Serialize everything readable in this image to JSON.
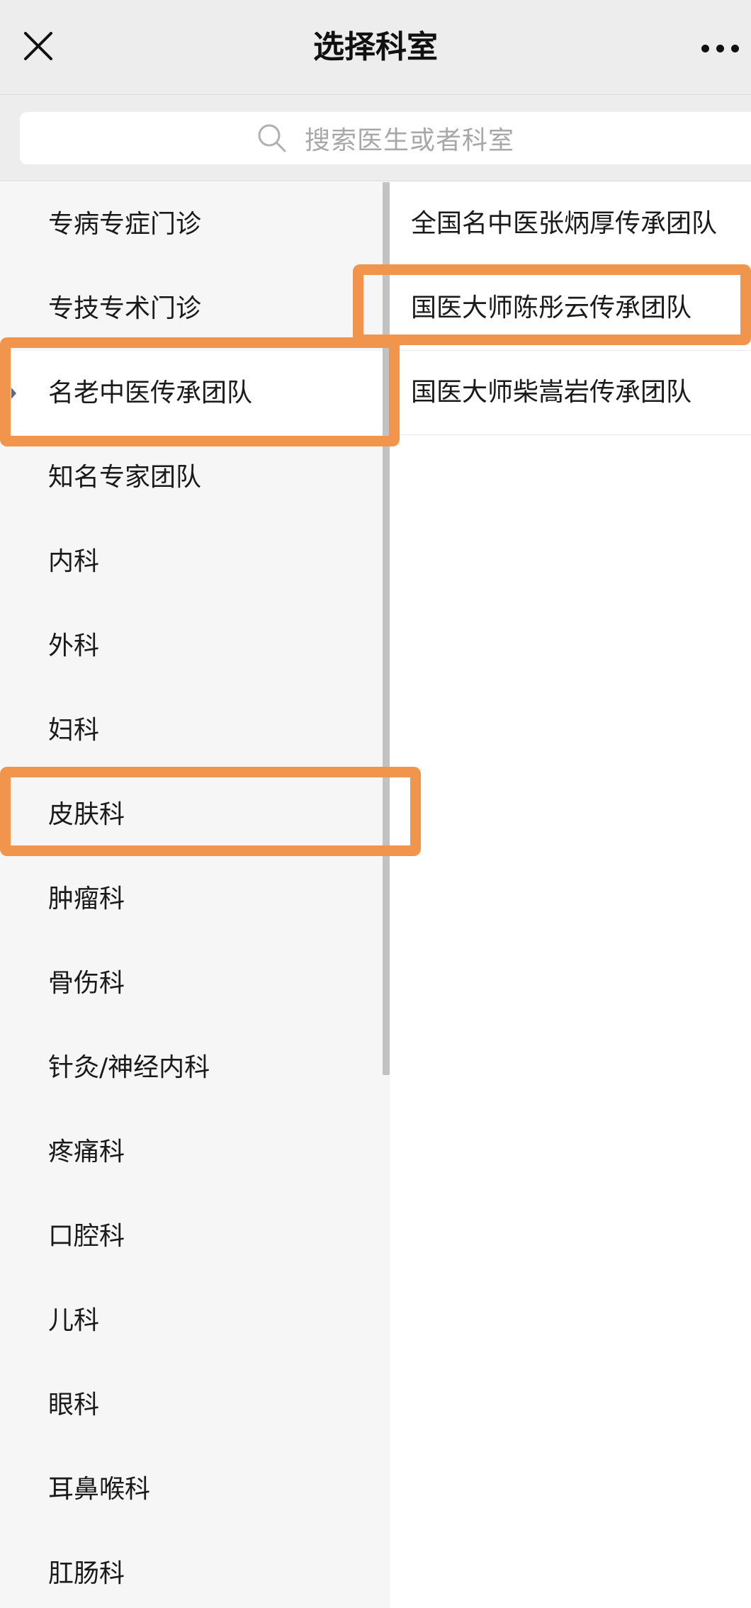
{
  "header": {
    "title": "选择科室",
    "close_icon": "close-icon",
    "more_icon": "more-dots-icon"
  },
  "search": {
    "placeholder": "搜索医生或者科室",
    "icon": "search-icon"
  },
  "departments": [
    {
      "label": "专病专症门诊",
      "active": false
    },
    {
      "label": "专技专术门诊",
      "active": false
    },
    {
      "label": "名老中医传承团队",
      "active": true
    },
    {
      "label": "知名专家团队",
      "active": false
    },
    {
      "label": "内科",
      "active": false
    },
    {
      "label": "外科",
      "active": false
    },
    {
      "label": "妇科",
      "active": false
    },
    {
      "label": "皮肤科",
      "active": false
    },
    {
      "label": "肿瘤科",
      "active": false
    },
    {
      "label": "骨伤科",
      "active": false
    },
    {
      "label": "针灸/神经内科",
      "active": false
    },
    {
      "label": "疼痛科",
      "active": false
    },
    {
      "label": "口腔科",
      "active": false
    },
    {
      "label": "儿科",
      "active": false
    },
    {
      "label": "眼科",
      "active": false
    },
    {
      "label": "耳鼻喉科",
      "active": false
    },
    {
      "label": "肛肠科",
      "active": false
    }
  ],
  "sub_items": [
    {
      "label": "全国名中医张炳厚传承团队"
    },
    {
      "label": "国医大师陈彤云传承团队"
    },
    {
      "label": "国医大师柴嵩岩传承团队"
    }
  ],
  "colors": {
    "highlight": "#f0954b",
    "header_bg": "#ededed",
    "left_bg": "#f6f6f6"
  }
}
